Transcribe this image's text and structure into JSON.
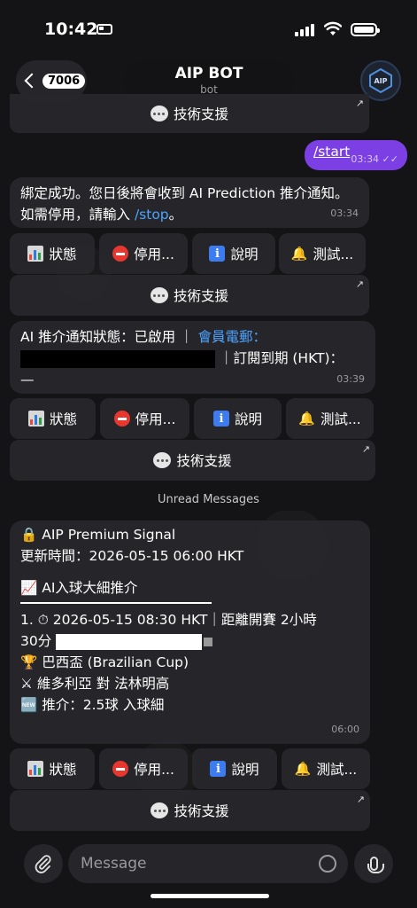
{
  "status_bar": {
    "time": "10:42"
  },
  "header": {
    "back_badge": "7006",
    "title": "AIP BOT",
    "subtitle": "bot",
    "avatar_text": "AIP"
  },
  "buttons": {
    "status": "狀態",
    "stop": "停用...",
    "help": "說明",
    "test": "測試...",
    "support": "技術支援"
  },
  "messages": {
    "start": {
      "text": "/start",
      "time": "03:34"
    },
    "bind": {
      "text": "綁定成功。您日後將會收到 AI Prediction 推介通知。如需停用，請輸入 ",
      "link": "/stop",
      "tail": "。",
      "time": "03:34"
    },
    "notify_status": {
      "line1": "AI 推介通知狀態：已啟用 ｜",
      "email_label": "會員電郵：",
      "sub_label": "｜訂閱到期 (HKT)：",
      "line3": "—",
      "time": "03:39"
    },
    "unread_label": "Unread Messages",
    "signal": {
      "heading": "AIP Premium Signal",
      "updated": "更新時間：2026-05-15 06:00 HKT",
      "section": "AI入球大細推介",
      "item_line1": "1. ⏱ 2026-05-15 08:30 HKT｜距離開賽 2小時",
      "item_line2": "30分",
      "cup": "巴西盃 (Brazilian Cup)",
      "match": "維多利亞 對 法林明高",
      "tip": "推介：2.5球 入球細",
      "time": "06:00"
    }
  },
  "input": {
    "placeholder": "Message"
  }
}
